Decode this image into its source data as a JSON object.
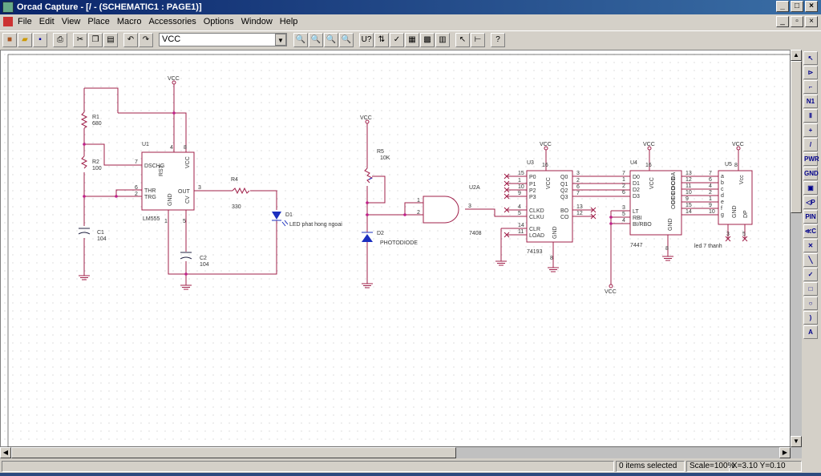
{
  "window": {
    "title": "Orcad Capture - [/ - (SCHEMATIC1 : PAGE1)]"
  },
  "menu": [
    "File",
    "Edit",
    "View",
    "Place",
    "Macro",
    "Accessories",
    "Options",
    "Window",
    "Help"
  ],
  "toolbar": {
    "part_value": "VCC",
    "left_icons": [
      "new-icon",
      "open-icon",
      "save-icon",
      "print-icon",
      "cut-icon",
      "copy-icon",
      "paste-icon",
      "undo-icon",
      "redo-icon"
    ],
    "right_icons": [
      "zoom-in-icon",
      "zoom-out-icon",
      "zoom-area-icon",
      "zoom-all-icon",
      "annotate-icon",
      "back-annotate-icon",
      "drc-icon",
      "netlist-icon",
      "cross-reference-icon",
      "bill-of-materials-icon",
      "snap-to-grid-icon",
      "project-manager-icon",
      "help-icon"
    ]
  },
  "palette": [
    {
      "icon": "select-icon",
      "glyph": "↖"
    },
    {
      "icon": "place-part-icon",
      "glyph": "⊳"
    },
    {
      "icon": "place-wire-icon",
      "glyph": "⌐"
    },
    {
      "icon": "net-alias-icon",
      "glyph": "N1"
    },
    {
      "icon": "place-bus-icon",
      "glyph": "Ⅱ"
    },
    {
      "icon": "junction-icon",
      "glyph": "+"
    },
    {
      "icon": "bus-entry-icon",
      "glyph": "/"
    },
    {
      "icon": "power-icon",
      "glyph": "PWR"
    },
    {
      "icon": "ground-icon",
      "glyph": "GND"
    },
    {
      "icon": "hierarchical-block-icon",
      "glyph": "▣"
    },
    {
      "icon": "hierarchical-port-icon",
      "glyph": "◁P"
    },
    {
      "icon": "hierarchical-pin-icon",
      "glyph": "PIN"
    },
    {
      "icon": "off-page-connector-icon",
      "glyph": "≪C"
    },
    {
      "icon": "no-connect-icon",
      "glyph": "✕"
    },
    {
      "icon": "line-icon",
      "glyph": "╲"
    },
    {
      "icon": "polyline-icon",
      "glyph": "✓"
    },
    {
      "icon": "rectangle-icon",
      "glyph": "□"
    },
    {
      "icon": "ellipse-icon",
      "glyph": "○"
    },
    {
      "icon": "arc-icon",
      "glyph": ")"
    },
    {
      "icon": "text-icon",
      "glyph": "A"
    }
  ],
  "schematic": {
    "vcc": "VCC",
    "r1": {
      "ref": "R1",
      "value": "680"
    },
    "r2": {
      "ref": "R2",
      "value": "100"
    },
    "c1": {
      "ref": "C1",
      "value": "104"
    },
    "c2": {
      "ref": "C2",
      "value": "104"
    },
    "r4": {
      "ref": "R4",
      "value": "330"
    },
    "d1": {
      "ref": "D1",
      "value": "LED phat hong ngoai"
    },
    "u1": {
      "ref": "U1",
      "part": "LM555",
      "pins": [
        "DSCHG",
        "THR",
        "TRG",
        "OUT",
        "RST",
        "VCC",
        "GND",
        "CV"
      ],
      "nums": [
        "7",
        "6",
        "2",
        "3",
        "4",
        "8",
        "1",
        "5"
      ]
    },
    "r5": {
      "ref": "R5",
      "value": "10K"
    },
    "d2": {
      "ref": "D2",
      "value": "PHOTODIODE"
    },
    "u2": {
      "ref": "U2A",
      "part": "7408",
      "nums": [
        "1",
        "2",
        "3"
      ]
    },
    "u3": {
      "ref": "U3",
      "part": "74193",
      "pins": [
        "P0",
        "P1",
        "P2",
        "P3",
        "CLKD",
        "CLKU",
        "CLR",
        "LOAD",
        "Q0",
        "Q1",
        "Q2",
        "Q3",
        "BO",
        "CO",
        "VCC",
        "GND"
      ],
      "nums": [
        "15",
        "1",
        "10",
        "9",
        "4",
        "5",
        "14",
        "11",
        "3",
        "2",
        "6",
        "7",
        "13",
        "12",
        "16",
        "8"
      ]
    },
    "u4": {
      "ref": "U4",
      "part": "7447",
      "pins": [
        "D0",
        "D1",
        "D2",
        "D3",
        "LT",
        "RBI",
        "BI/RBO",
        "VCC",
        "GND",
        "OA",
        "OB",
        "OC",
        "OD",
        "OE",
        "OF",
        "OG"
      ],
      "nums": [
        "7",
        "1",
        "2",
        "6",
        "3",
        "5",
        "4",
        "16",
        "8",
        "13",
        "12",
        "11",
        "10",
        "9",
        "15",
        "14"
      ]
    },
    "u5": {
      "ref": "U5",
      "part": "led 7 thanh",
      "pins": [
        "a",
        "b",
        "c",
        "d",
        "e",
        "f",
        "g",
        "Vcc",
        "GND",
        "DP"
      ],
      "nums": [
        "7",
        "6",
        "4",
        "2",
        "1",
        "9",
        "10",
        "8",
        "3",
        "5"
      ]
    }
  },
  "status": {
    "message": "",
    "selection": "0 items selected",
    "scale": "Scale=100%",
    "coords": "X=3.10  Y=0.10"
  }
}
